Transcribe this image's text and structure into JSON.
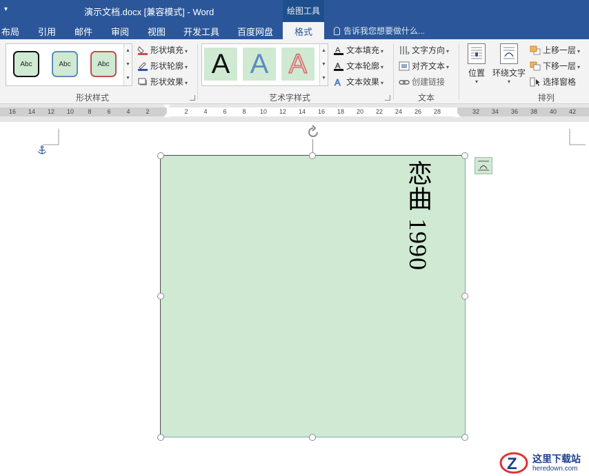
{
  "window": {
    "quick_access": "▾",
    "title": "演示文档.docx [兼容模式] - Word",
    "contextual_tab_group": "绘图工具"
  },
  "tabs": [
    {
      "label": "布局"
    },
    {
      "label": "引用"
    },
    {
      "label": "邮件"
    },
    {
      "label": "审阅"
    },
    {
      "label": "视图"
    },
    {
      "label": "开发工具"
    },
    {
      "label": "百度网盘"
    },
    {
      "label": "格式",
      "active": true
    }
  ],
  "tell_me": "告诉我您想要做什么...",
  "ribbon": {
    "shape_styles": {
      "gallery": [
        "Abc",
        "Abc",
        "Abc"
      ],
      "fill": "形状填充",
      "outline": "形状轮廓",
      "effects": "形状效果",
      "label": "形状样式"
    },
    "wordart": {
      "gallery": [
        "A",
        "A",
        "A"
      ],
      "text_fill": "文本填充",
      "text_outline": "文本轮廓",
      "text_effects": "文本效果",
      "label": "艺术字样式"
    },
    "text": {
      "direction": "文字方向",
      "align": "对齐文本",
      "link": "创建链接",
      "label": "文本"
    },
    "arrange": {
      "position": "位置",
      "wrap": "环绕文字",
      "forward": "上移一层",
      "backward": "下移一层",
      "selection_pane": "选择窗格",
      "label": "排列"
    }
  },
  "ruler": {
    "numbers": [
      "16",
      "14",
      "12",
      "10",
      "8",
      "6",
      "4",
      "2",
      "2",
      "4",
      "6",
      "8",
      "10",
      "12",
      "14",
      "16",
      "18",
      "20",
      "22",
      "24",
      "26",
      "28",
      "32",
      "34",
      "36",
      "38",
      "40",
      "42"
    ]
  },
  "document": {
    "shape_text": "恋曲 1990",
    "shape_fill": "#cfe9d3"
  },
  "watermark": {
    "title": "这里下载站",
    "url": "heredown.com"
  },
  "colors": {
    "titlebar": "#2b579a",
    "ribbon": "#f3f3f3",
    "accent": "#2b579a"
  }
}
